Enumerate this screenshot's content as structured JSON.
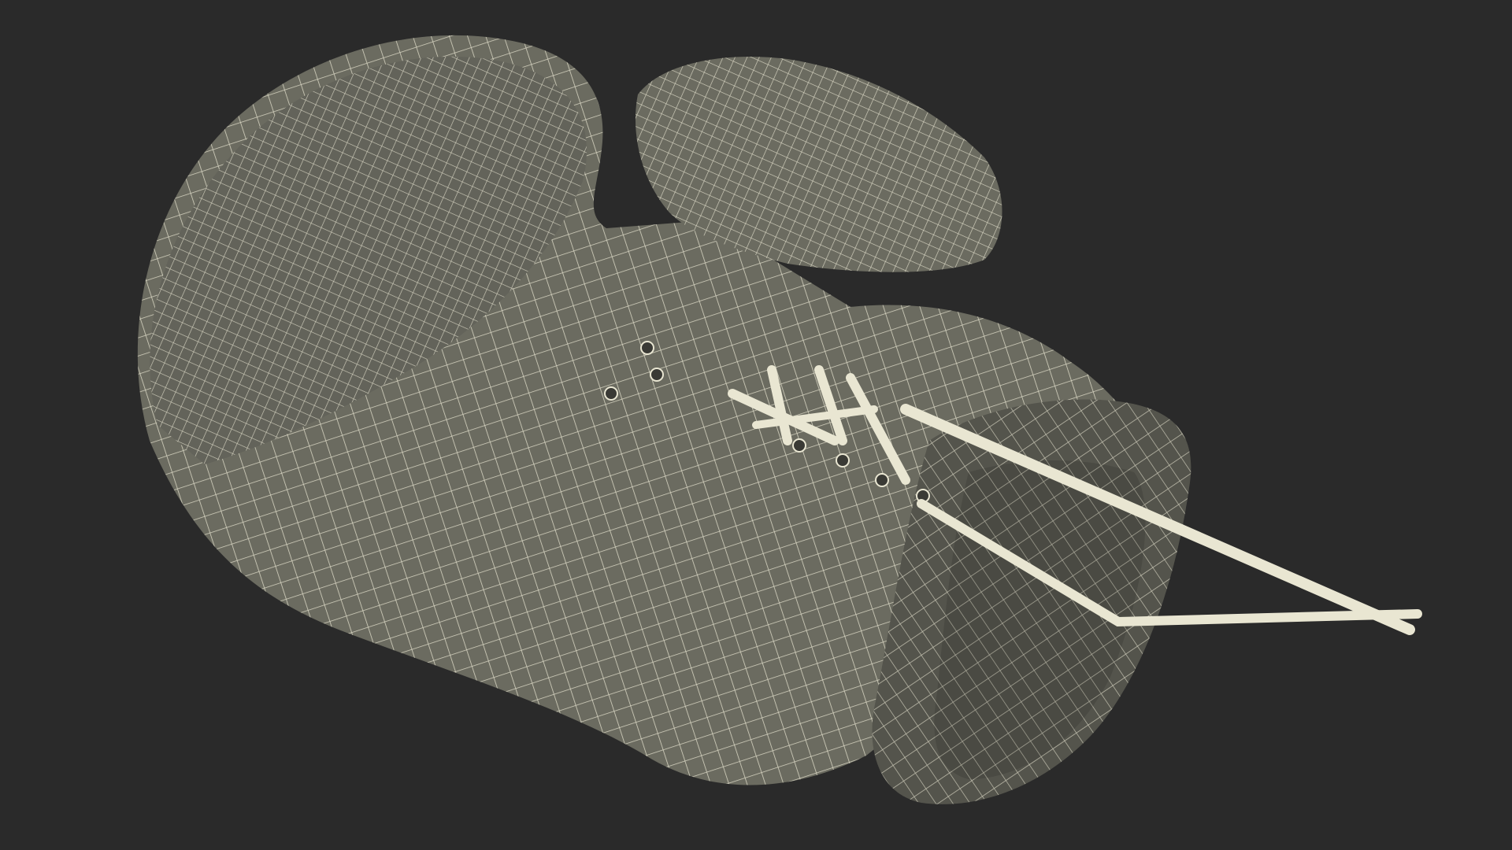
{
  "scene": {
    "background_color": "#2a2a2a",
    "model_fill_color": "#6b6b60",
    "model_shade_color": "#54544c",
    "wire_color": "#e9e6d2",
    "object": "boxing-glove",
    "render_mode": "wireframe-on-shaded"
  }
}
